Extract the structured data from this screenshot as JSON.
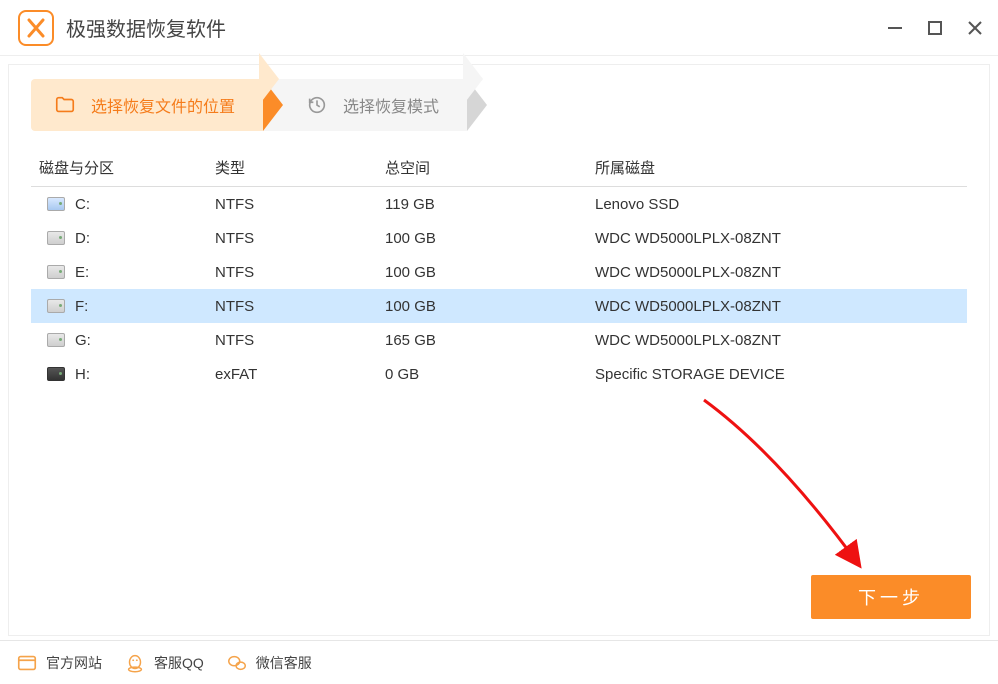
{
  "app": {
    "title": "极强数据恢复软件"
  },
  "window_controls": {
    "min": "minimize",
    "max": "maximize",
    "close": "close"
  },
  "steps": {
    "step1": {
      "label": "选择恢复文件的位置",
      "active": true
    },
    "step2": {
      "label": "选择恢复模式",
      "active": false
    }
  },
  "table": {
    "headers": {
      "disk": "磁盘与分区",
      "type": "类型",
      "size": "总空间",
      "belong": "所属磁盘"
    },
    "rows": [
      {
        "drive": "C:",
        "type": "NTFS",
        "size": "119 GB",
        "belong": "Lenovo SSD",
        "icon": "system",
        "selected": false
      },
      {
        "drive": "D:",
        "type": "NTFS",
        "size": "100 GB",
        "belong": "WDC WD5000LPLX-08ZNT",
        "icon": "hdd",
        "selected": false
      },
      {
        "drive": "E:",
        "type": "NTFS",
        "size": "100 GB",
        "belong": "WDC WD5000LPLX-08ZNT",
        "icon": "hdd",
        "selected": false
      },
      {
        "drive": "F:",
        "type": "NTFS",
        "size": "100 GB",
        "belong": "WDC WD5000LPLX-08ZNT",
        "icon": "hdd",
        "selected": true
      },
      {
        "drive": "G:",
        "type": "NTFS",
        "size": "165 GB",
        "belong": "WDC WD5000LPLX-08ZNT",
        "icon": "hdd",
        "selected": false
      },
      {
        "drive": "H:",
        "type": "exFAT",
        "size": "0 GB",
        "belong": "Specific STORAGE DEVICE",
        "icon": "usb",
        "selected": false
      }
    ]
  },
  "buttons": {
    "next": "下一步"
  },
  "bottom_links": {
    "website": "官方网站",
    "qq": "客服QQ",
    "wechat": "微信客服"
  }
}
